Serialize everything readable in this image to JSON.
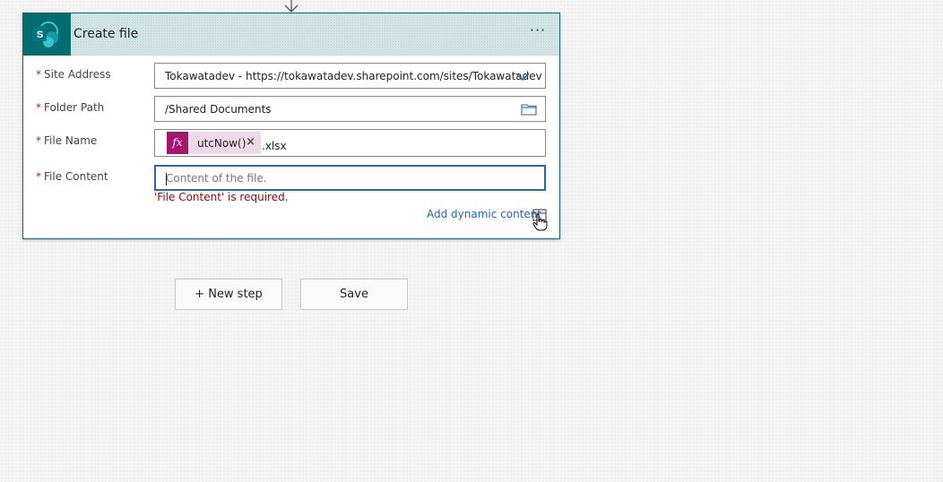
{
  "card": {
    "title": "Create file",
    "more_label": "···",
    "required_marker": "*",
    "fields": {
      "site_address": {
        "label": "Site Address",
        "value": "Tokawatadev - https://tokawatadev.sharepoint.com/sites/Tokawatadev"
      },
      "folder_path": {
        "label": "Folder Path",
        "value": "/Shared Documents"
      },
      "file_name": {
        "label": "File Name",
        "token_label": "utcNow()",
        "token_icon": "fx",
        "token_close": "×",
        "suffix": ".xlsx"
      },
      "file_content": {
        "label": "File Content",
        "placeholder": "Content of the file.",
        "error": "'File Content' is required."
      }
    },
    "dynamic_content_link": "Add dynamic content"
  },
  "actions": {
    "new_step": "+ New step",
    "save": "Save"
  },
  "colors": {
    "sharepoint": "#036c70",
    "expression_token": "#a4166e",
    "link": "#2266b3",
    "error": "#a80000"
  },
  "icons": {
    "connector": "down-arrow-icon",
    "service": "sharepoint-icon",
    "dropdown": "chevron-down-icon",
    "folder": "folder-icon",
    "expression": "fx-icon",
    "dynamic": "dynamic-content-icon"
  }
}
